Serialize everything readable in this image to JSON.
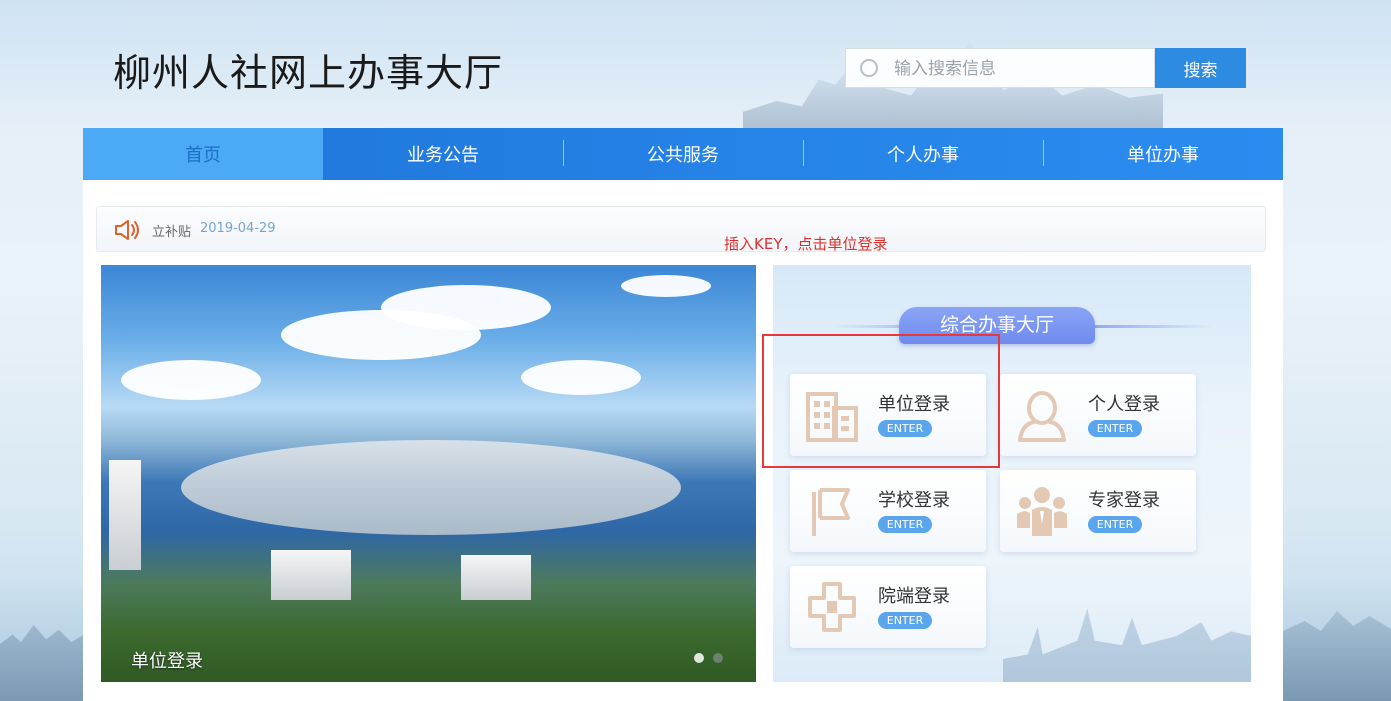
{
  "header": {
    "site_title": "柳州人社网上办事大厅",
    "search_placeholder": "输入搜索信息",
    "search_button": "搜索"
  },
  "nav": {
    "items": [
      {
        "label": "首页",
        "active": true
      },
      {
        "label": "业务公告",
        "active": false
      },
      {
        "label": "公共服务",
        "active": false
      },
      {
        "label": "个人办事",
        "active": false
      },
      {
        "label": "单位办事",
        "active": false
      }
    ]
  },
  "notice": {
    "title": "立补贴",
    "date": "2019-04-29"
  },
  "annotation": {
    "text": "插入KEY，点击单位登录"
  },
  "banner": {
    "caption": "单位登录",
    "slide_count": 2,
    "active_slide": 1
  },
  "service_panel": {
    "title": "综合办事大厅",
    "cards": [
      {
        "label": "单位登录",
        "enter": "ENTER",
        "icon": "building-icon"
      },
      {
        "label": "个人登录",
        "enter": "ENTER",
        "icon": "person-icon"
      },
      {
        "label": "学校登录",
        "enter": "ENTER",
        "icon": "flag-icon"
      },
      {
        "label": "专家登录",
        "enter": "ENTER",
        "icon": "group-icon"
      },
      {
        "label": "院端登录",
        "enter": "ENTER",
        "icon": "cross-icon"
      }
    ]
  },
  "colors": {
    "nav_bg": "#2684e8",
    "nav_active_bg": "#4ba9f5",
    "search_button_bg": "#2e8be2",
    "enter_badge": "#59a5ee",
    "panel_title_bg": "#7d96ee",
    "annotation_red": "#e0302c",
    "notice_date": "#74a4d6",
    "icon_tan": "#e3c9b4"
  }
}
